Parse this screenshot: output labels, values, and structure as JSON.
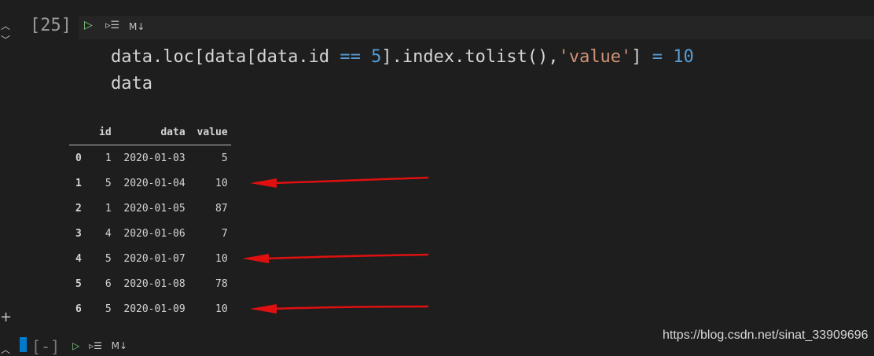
{
  "cell": {
    "execution_count": "[25]",
    "toolbar": {
      "run_icon": "play-icon",
      "run_all_icon": "run-all-icon",
      "markdown_label": "M↓"
    },
    "code_lines": [
      [
        {
          "t": "data.loc[data[data.id ",
          "c": "plain"
        },
        {
          "t": "==",
          "c": "op"
        },
        {
          "t": " ",
          "c": "plain"
        },
        {
          "t": "5",
          "c": "num"
        },
        {
          "t": "].index.tolist(),",
          "c": "plain"
        },
        {
          "t": "'value'",
          "c": "str"
        },
        {
          "t": "] ",
          "c": "plain"
        },
        {
          "t": "=",
          "c": "op"
        },
        {
          "t": " ",
          "c": "plain"
        },
        {
          "t": "10",
          "c": "num"
        }
      ],
      [
        {
          "t": "data",
          "c": "plain"
        }
      ]
    ]
  },
  "output_table": {
    "columns": [
      "",
      "id",
      "data",
      "value"
    ],
    "rows": [
      [
        "0",
        "1",
        "2020-01-03",
        "5"
      ],
      [
        "1",
        "5",
        "2020-01-04",
        "10"
      ],
      [
        "2",
        "1",
        "2020-01-05",
        "87"
      ],
      [
        "3",
        "4",
        "2020-01-06",
        "7"
      ],
      [
        "4",
        "5",
        "2020-01-07",
        "10"
      ],
      [
        "5",
        "6",
        "2020-01-08",
        "78"
      ],
      [
        "6",
        "5",
        "2020-01-09",
        "10"
      ]
    ]
  },
  "annotations": {
    "arrow_color": "#e01010",
    "highlighted_rows": [
      1,
      4,
      6
    ]
  },
  "next_cell": {
    "execution_count": "[-]",
    "markdown_label": "M↓"
  },
  "watermark": "https://blog.csdn.net/sinat_33909696"
}
